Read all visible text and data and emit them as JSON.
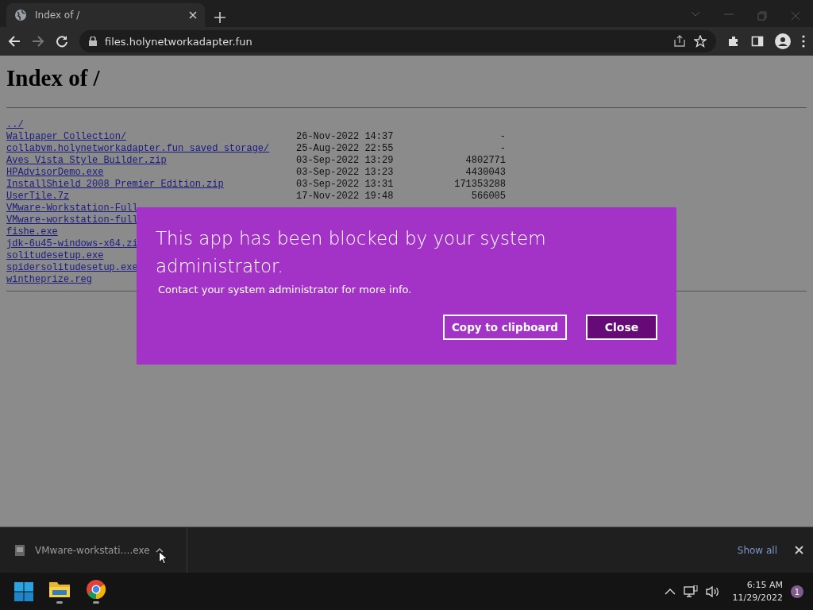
{
  "browser": {
    "tab": {
      "title": "Index of /",
      "selected": true
    },
    "url": "files.holynetworkadapter.fun"
  },
  "page": {
    "heading": "Index of /",
    "rows": [
      {
        "name": "../"
      },
      {
        "name": "Wallpaper Collection/",
        "date": "26-Nov-2022 14:37",
        "size": "-"
      },
      {
        "name": "collabvm.holynetworkadapter.fun saved storage/",
        "date": "25-Aug-2022 22:55",
        "size": "-"
      },
      {
        "name": "Aves Vista Style Builder.zip",
        "date": "03-Sep-2022 13:29",
        "size": "4802771"
      },
      {
        "name": "HPAdvisorDemo.exe",
        "date": "03-Sep-2022 13:23",
        "size": "4430043"
      },
      {
        "name": "InstallShield_2008_Premier_Edition.zip",
        "date": "03-Sep-2022 13:31",
        "size": "171353288"
      },
      {
        "name": "UserTile.7z",
        "date": "17-Nov-2022 19:48",
        "size": "566005"
      },
      {
        "name": "VMware-Workstation-Full"
      },
      {
        "name": "VMware-workstation-full"
      },
      {
        "name": "fishe.exe"
      },
      {
        "name": "jdk-6u45-windows-x64.zi"
      },
      {
        "name": "solitudesetup.exe"
      },
      {
        "name": "spidersolitudesetup.exe"
      },
      {
        "name": "wintheprize.reg"
      }
    ]
  },
  "dialog": {
    "title": "This app has been blocked by your system administrator.",
    "message": "Contact your system administrator for more info.",
    "buttons": [
      {
        "label": "Copy to clipboard",
        "kind": "secondary"
      },
      {
        "label": "Close",
        "kind": "primary"
      }
    ]
  },
  "download_bar": {
    "file": "VMware-workstati….exe",
    "show_all": "Show all"
  },
  "taskbar": {
    "time": "6:15 AM",
    "date": "11/29/2022",
    "notifications": "1"
  }
}
